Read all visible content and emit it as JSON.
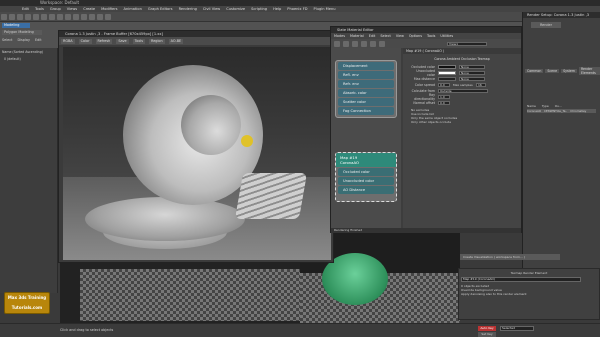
{
  "app": {
    "title": "Workspace: Default"
  },
  "menu": [
    "Edit",
    "Tools",
    "Group",
    "Views",
    "Create",
    "Modifiers",
    "Animation",
    "Graph Editors",
    "Rendering",
    "Civil View",
    "Customize",
    "Scripting",
    "Help",
    "Phoenix FD",
    "Plugin Menu"
  ],
  "ribbon": {
    "tabs": [
      "Modeling"
    ],
    "subtab": "Polygon Modeling",
    "left_labels": [
      "Select",
      "Display",
      "Edit"
    ]
  },
  "scene_explorer": {
    "title": "Name (Sorted Ascending)",
    "item": "0 (default)"
  },
  "vfb": {
    "title": "Corona 1.3 Justin ,3 - Frame Buffer [670x459px] [1.xx]",
    "tools": [
      "RGBA",
      "Color",
      "Refresh",
      "Save",
      "Tools",
      "Region",
      "AO-BE"
    ]
  },
  "sme": {
    "title": "Slate Material Editor",
    "menu": [
      "Modes",
      "Material",
      "Edit",
      "Select",
      "View",
      "Options",
      "Tools",
      "Utilities"
    ],
    "view_name": "View1",
    "node1": {
      "slots": [
        "Displacement",
        "Refl. env",
        "Refr. env",
        "Absorb. color",
        "Scatter color",
        "Fog Connection"
      ]
    },
    "node2": {
      "title1": "Map #19",
      "title2": "CoronaAO",
      "slots": [
        "Occluded color",
        "Unoccluded color",
        "AO Distance"
      ]
    },
    "props_header": "Map #19 ( CoronaAO )",
    "props_rows": [
      {
        "label": "Occluded color",
        "value": "None"
      },
      {
        "label": "Unoccluded color",
        "value": "None"
      },
      {
        "label": "Max distance",
        "value": "None"
      },
      {
        "label": "Color spread",
        "value": "0.0"
      },
      {
        "label": "Max samples",
        "value": "16"
      },
      {
        "label": "Calculate from",
        "value": "Outside"
      },
      {
        "label": "Ray directionality",
        "value": "1.0"
      },
      {
        "label": "Normal offset",
        "value": "0.0"
      }
    ],
    "section_title": "Corona Ambient Occlusion Texmap",
    "excludes": [
      "No excludes",
      "Use include list",
      "Only the same object occludes",
      "Only other objects occlude"
    ],
    "footer": "Rendering finished"
  },
  "render_setup": {
    "title": "Render Setup: Corona 1.3 Justin ,3",
    "render_btn": "Render",
    "tabs": [
      "Common",
      "Scene",
      "System",
      "Render Elements"
    ],
    "table_headers": [
      "Name",
      "Type",
      "Ou..."
    ],
    "table_row": [
      "CoronaAO",
      "CESSENTIAL_Te..",
      "ChromaKey"
    ],
    "texmap": {
      "label": "Texmap Render Element",
      "texmap": "Map #19 (CoronaAO)",
      "row2": "0 objects excluded",
      "override": "Override background value",
      "mode": "Apply denoising also to this render element"
    },
    "create_btn": "Create Visualization ( workspace from... )"
  },
  "logo": {
    "line1": "Max 3ds Training",
    "line2": "Tutorials.com"
  },
  "status": {
    "hint": "Click and drag to select objects",
    "auto_key": "Auto Key",
    "selected": "Selected",
    "set_key": "Set Key"
  },
  "colors": {
    "accent": "#e3c21a",
    "node_teal": "#2e8a7a"
  }
}
